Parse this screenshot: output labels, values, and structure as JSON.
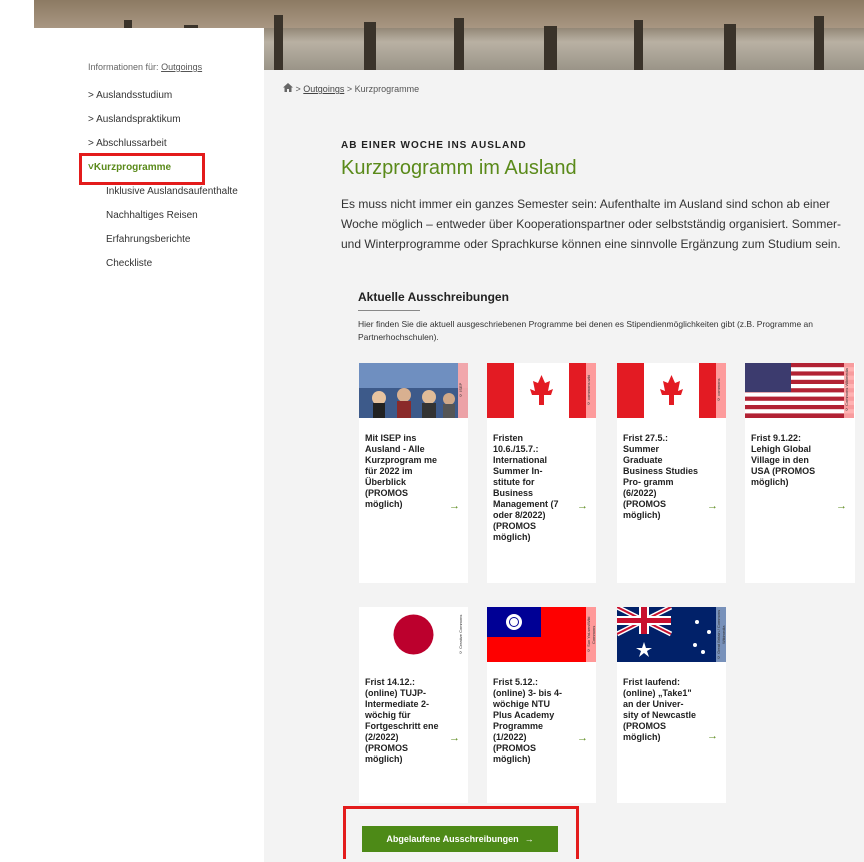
{
  "sidebar": {
    "info_label": "Informationen für:",
    "info_link": "Outgoings",
    "items": [
      {
        "label": "Auslandsstudium",
        "prefix": ">"
      },
      {
        "label": "Auslandspraktikum",
        "prefix": ">"
      },
      {
        "label": "Abschlussarbeit",
        "prefix": ">"
      },
      {
        "label": "Kurzprogramme",
        "prefix": "˅"
      }
    ],
    "subitems": [
      {
        "label": "Inklusive Auslandsaufenthalte"
      },
      {
        "label": "Nachhaltiges Reisen"
      },
      {
        "label": "Erfahrungsberichte"
      },
      {
        "label": "Checkliste"
      }
    ]
  },
  "breadcrumb": {
    "home_icon": "home-icon",
    "sep": ">",
    "link": "Outgoings",
    "current": "Kurzprogramme"
  },
  "main": {
    "kicker": "AB EINER WOCHE INS AUSLAND",
    "title": "Kurzprogramm im Ausland",
    "lead": "Es muss nicht immer ein ganzes Semester sein: Aufenthalte im Ausland sind schon ab einer Woche möglich – entweder über Kooperationspartner oder selbstständig organisiert. Sommer- und Winterprogramme oder Sprachkurse können eine sinnvolle Ergänzung zum Studium sein.",
    "section_title": "Aktuelle Ausschreibungen",
    "section_desc": "Hier finden Sie die aktuell ausgeschriebenen Programme bei denen es Stipendienmöglichkeiten gibt (z.B. Programme an Partnerhochschulen).",
    "cards": [
      {
        "text": "Mit ISEP ins Ausland - Alle Kurzprogram me für 2022 im Überblick (PROMOS möglich)",
        "credit": "© ISEP",
        "image": "photo-students"
      },
      {
        "text": "Fristen 10.6./15.7.: International Summer In- stitute for Business Management (7 oder 8/2022) (PROMOS möglich)",
        "credit": "© commons.wiki",
        "image": "canada-flag"
      },
      {
        "text": "Frist 27.5.: Summer Graduate Business Studies Pro- gramm (6/2022) (PROMOS möglich)",
        "credit": "© commons",
        "image": "canada-flag"
      },
      {
        "text": "Frist 9.1.22: Lehigh Global Village in den USA (PROMOS möglich)",
        "credit": "© Commons Wikimedia",
        "image": "usa-flag"
      },
      {
        "text": "Frist 14.12.: (online) TUJP- Intermediate 2-wöchig für Fortgeschritt ene (2/2022) (PROMOS möglich)",
        "credit": "© Creative Commons",
        "image": "japan-flag"
      },
      {
        "text": "Frist 5.12.: (online) 3- bis 4-wöchige NTU Plus Academy Programme (1/2022) (PROMOS möglich)",
        "credit": "© Sun Yat-sen/Wiki Commons",
        "image": "taiwan-flag"
      },
      {
        "text": "Frist laufend: (online) „Take1\" an der Univer- sity of Newcastle (PROMOS möglich)",
        "credit": "© Great Britain / Commons Wikimedia",
        "image": "australia-flag"
      }
    ],
    "button_label": "Abgelaufene Ausschreibungen",
    "arrow": "→"
  },
  "colors": {
    "accent": "#5a8a1a",
    "button": "#4d8a17",
    "highlight": "#e31b1b"
  }
}
